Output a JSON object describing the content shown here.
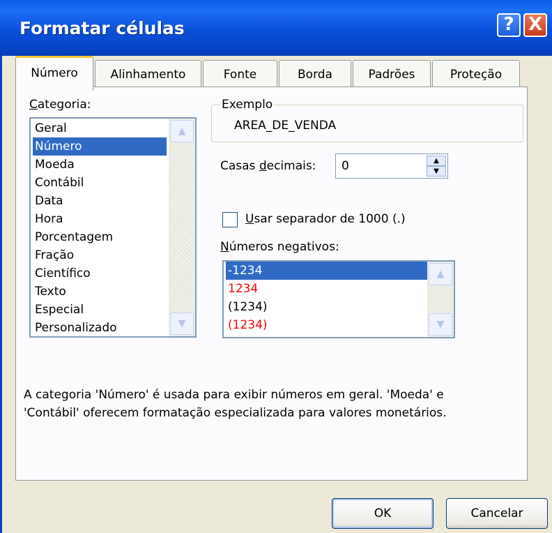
{
  "window": {
    "title": "Formatar células",
    "help_glyph": "?",
    "close_glyph": "X"
  },
  "tabs": [
    {
      "label": "Número",
      "active": true
    },
    {
      "label": "Alinhamento",
      "active": false
    },
    {
      "label": "Fonte",
      "active": false
    },
    {
      "label": "Borda",
      "active": false
    },
    {
      "label": "Padrões",
      "active": false
    },
    {
      "label": "Proteção",
      "active": false
    }
  ],
  "category": {
    "label_mnemonic": "C",
    "label_rest": "ategoria:",
    "items": [
      "Geral",
      "Número",
      "Moeda",
      "Contábil",
      "Data",
      "Hora",
      "Porcentagem",
      "Fração",
      "Científico",
      "Texto",
      "Especial",
      "Personalizado"
    ],
    "selected": "Número"
  },
  "example": {
    "label": "Exemplo",
    "value": "AREA_DE_VENDA"
  },
  "decimals": {
    "label_pre": "Casas ",
    "label_mnemonic": "d",
    "label_post": "ecimais:",
    "value": "0"
  },
  "separator": {
    "label_mnemonic": "U",
    "label_rest": "sar separador de 1000 (.)",
    "checked": false
  },
  "negatives": {
    "label_mnemonic": "N",
    "label_rest": "úmeros negativos:",
    "items": [
      {
        "text": "-1234",
        "color": "#000000",
        "selected": true
      },
      {
        "text": "1234",
        "color": "#FF0000",
        "selected": false
      },
      {
        "text": "(1234)",
        "color": "#000000",
        "selected": false
      },
      {
        "text": "(1234)",
        "color": "#FF0000",
        "selected": false
      }
    ]
  },
  "description": {
    "line1": "A categoria 'Número' é usada para exibir números em geral. 'Moeda' e",
    "line2": "'Contábil' oferecem formatação especializada para valores monetários."
  },
  "buttons": {
    "ok": "OK",
    "cancel": "Cancelar"
  },
  "colors": {
    "title_bar": "#0B4FD8",
    "selection": "#316AC5",
    "dialog_bg": "#ECE9D8",
    "negative_red": "#FF0000"
  }
}
